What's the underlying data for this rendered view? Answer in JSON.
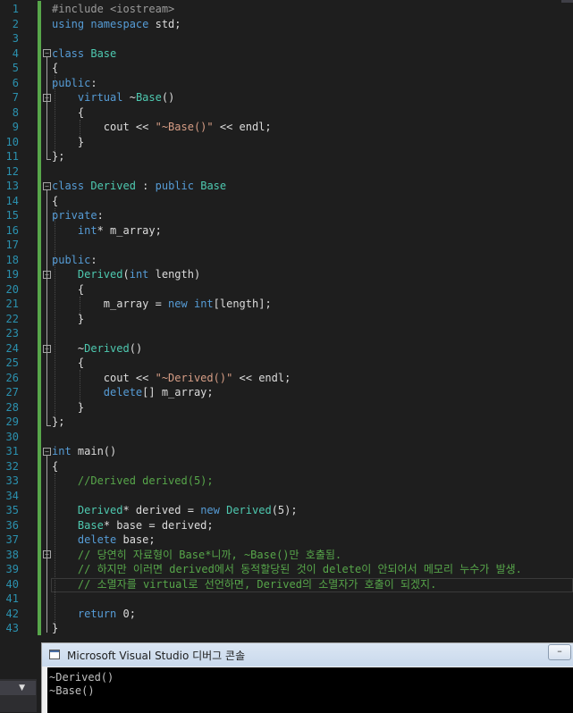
{
  "editor": {
    "line_numbers": [
      "1",
      "2",
      "3",
      "4",
      "5",
      "6",
      "7",
      "8",
      "9",
      "10",
      "11",
      "12",
      "13",
      "14",
      "15",
      "16",
      "17",
      "18",
      "19",
      "20",
      "21",
      "22",
      "23",
      "24",
      "25",
      "26",
      "27",
      "28",
      "29",
      "30",
      "31",
      "32",
      "33",
      "34",
      "35",
      "36",
      "37",
      "38",
      "39",
      "40",
      "41",
      "42",
      "43"
    ],
    "code": {
      "l1_pp": "#include <iostream>",
      "l2_kw": "using namespace",
      "l2_rest": " std;",
      "l4_kw": "class",
      "l4_ty": "Base",
      "l5": "{",
      "l6_kw": "public",
      "l6_rest": ":",
      "l7_kw": "virtual",
      "l7_rest": " ~",
      "l7_ty": "Base",
      "l7_end": "()",
      "l8": "{",
      "l9_a": "cout << ",
      "l9_str": "\"~Base()\"",
      "l9_b": " << endl;",
      "l10": "}",
      "l11": "};",
      "l13_kw": "class",
      "l13_ty": "Derived",
      "l13_mid": " : ",
      "l13_kw2": "public",
      "l13_ty2": "Base",
      "l14": "{",
      "l15_kw": "private",
      "l15_rest": ":",
      "l16_kw": "int",
      "l16_rest": "* m_array;",
      "l18_kw": "public",
      "l18_rest": ":",
      "l19_ty": "Derived",
      "l19_a": "(",
      "l19_kw": "int",
      "l19_b": " length)",
      "l20": "{",
      "l21_a": "m_array = ",
      "l21_kw": "new",
      "l21_sp": " ",
      "l21_kw2": "int",
      "l21_b": "[length];",
      "l22": "}",
      "l24_a": "~",
      "l24_ty": "Derived",
      "l24_b": "()",
      "l25": "{",
      "l26_a": "cout << ",
      "l26_str": "\"~Derived()\"",
      "l26_b": " << endl;",
      "l27_kw": "delete",
      "l27_rest": "[] m_array;",
      "l28": "}",
      "l29": "};",
      "l31_kw": "int",
      "l31_rest": " main()",
      "l32": "{",
      "l33_cm": "//Derived derived(5);",
      "l35_ty": "Derived",
      "l35_a": "* derived = ",
      "l35_kw": "new",
      "l35_sp": " ",
      "l35_ty2": "Derived",
      "l35_b": "(5);",
      "l36_ty": "Base",
      "l36_rest": "* base = derived;",
      "l37_kw": "delete",
      "l37_rest": " base;",
      "l38_cm": "// 당연히 자료형이 Base*니까, ~Base()만 호출됨.",
      "l39_cm": "// 하지만 이러면 derived에서 동적할당된 것이 delete이 안되어서 메모리 누수가 발생.",
      "l40_cm": "// 소멸자를 virtual로 선언하면, Derived의 소멸자가 호출이 되겠지.",
      "l42_kw": "return",
      "l42_rest": " 0;",
      "l43": "}"
    }
  },
  "console": {
    "title": "Microsoft Visual Studio 디버그 콘솔",
    "output": [
      "~Derived()",
      "~Base()"
    ]
  },
  "colors": {
    "keyword": "#569cd6",
    "type": "#4ec9b0",
    "string": "#d69d85",
    "comment": "#57a64a",
    "preprocessor": "#9b9b9b",
    "line_number": "#2b91af",
    "editor_bg": "#1e1e1e"
  },
  "icons": {
    "app": "console-window-icon",
    "minimize": "minimize-icon",
    "fold": "collapse-box-icon",
    "dropdown": "dropdown-arrow-icon"
  }
}
